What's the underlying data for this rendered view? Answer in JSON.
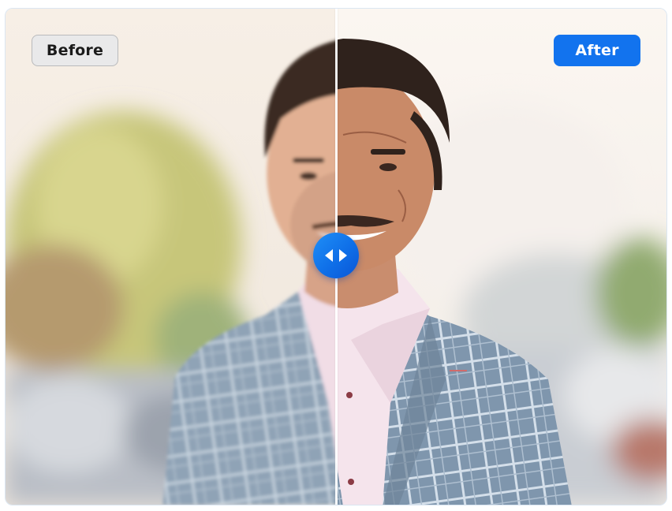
{
  "comparison": {
    "before_label": "Before",
    "after_label": "After",
    "slider_position": 0.5,
    "accent_color": "#1273ee",
    "handle_icon": "left-right-arrows-icon"
  }
}
